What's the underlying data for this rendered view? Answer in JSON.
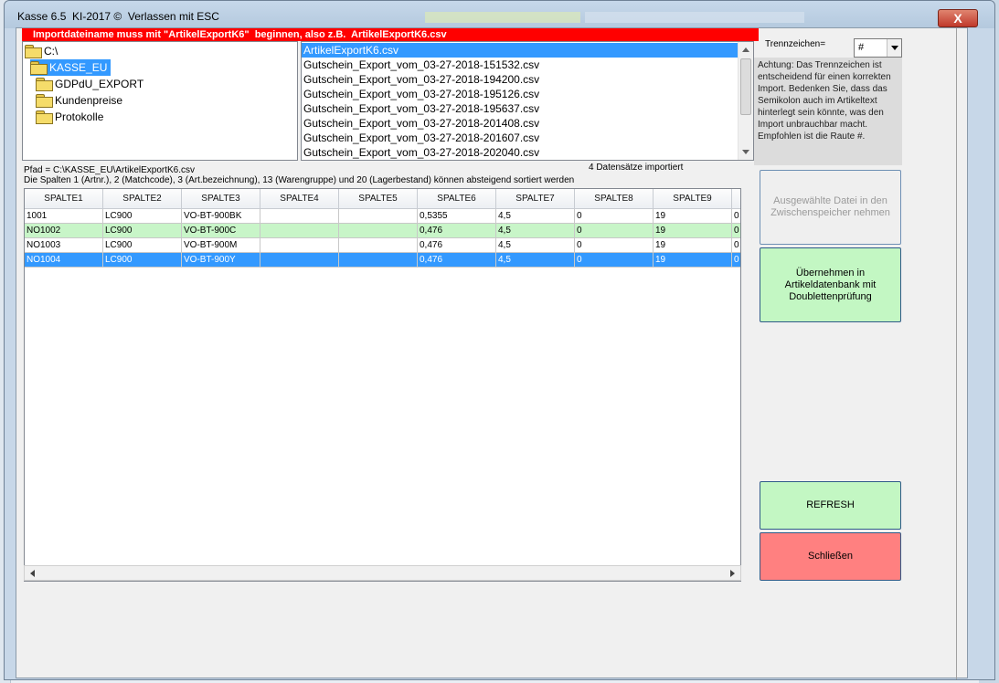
{
  "window": {
    "title": "Kasse 6.5  KI-2017 ©  Verlassen mit ESC",
    "close_label": "X"
  },
  "warning_bar": "Importdateiname muss mit \"ArtikelExportK6\"  beginnen, also z.B.  ArtikelExportK6.csv",
  "folders": [
    {
      "label": "C:\\",
      "level": 0,
      "selected": false
    },
    {
      "label": "KASSE_EU",
      "level": 1,
      "selected": true
    },
    {
      "label": "GDPdU_EXPORT",
      "level": 2,
      "selected": false
    },
    {
      "label": "Kundenpreise",
      "level": 2,
      "selected": false
    },
    {
      "label": "Protokolle",
      "level": 2,
      "selected": false
    }
  ],
  "files": [
    {
      "name": "ArtikelExportK6.csv",
      "selected": true
    },
    {
      "name": "Gutschein_Export_vom_03-27-2018-151532.csv",
      "selected": false
    },
    {
      "name": "Gutschein_Export_vom_03-27-2018-194200.csv",
      "selected": false
    },
    {
      "name": "Gutschein_Export_vom_03-27-2018-195126.csv",
      "selected": false
    },
    {
      "name": "Gutschein_Export_vom_03-27-2018-195637.csv",
      "selected": false
    },
    {
      "name": "Gutschein_Export_vom_03-27-2018-201408.csv",
      "selected": false
    },
    {
      "name": "Gutschein_Export_vom_03-27-2018-201607.csv",
      "selected": false
    },
    {
      "name": "Gutschein_Export_vom_03-27-2018-202040.csv",
      "selected": false
    }
  ],
  "path_text": "Pfad =  C:\\KASSE_EU\\ArtikelExportK6.csv",
  "records_text": "4  Datensätze importiert",
  "sort_hint": "Die Spalten 1 (Artnr.), 2 (Matchcode), 3 (Art.bezeichnung), 13 (Warengruppe) und 20 (Lagerbestand) können absteigend sortiert werden",
  "table": {
    "columns": [
      "SPALTE1",
      "SPALTE2",
      "SPALTE3",
      "SPALTE4",
      "SPALTE5",
      "SPALTE6",
      "SPALTE7",
      "SPALTE8",
      "SPALTE9"
    ],
    "rows": [
      {
        "state": "normal",
        "cells": [
          "1001",
          "LC900",
          "VO-BT-900BK",
          "",
          "",
          "0,5355",
          "4,5",
          "0",
          "19",
          "0"
        ]
      },
      {
        "state": "green",
        "cells": [
          "NO1002",
          "LC900",
          "VO-BT-900C",
          "",
          "",
          "0,476",
          "4,5",
          "0",
          "19",
          "0"
        ]
      },
      {
        "state": "normal",
        "cells": [
          "NO1003",
          "LC900",
          "VO-BT-900M",
          "",
          "",
          "0,476",
          "4,5",
          "0",
          "19",
          "0"
        ]
      },
      {
        "state": "selected",
        "cells": [
          "NO1004",
          "LC900",
          "VO-BT-900Y",
          "",
          "",
          "0,476",
          "4,5",
          "0",
          "19",
          "0"
        ]
      }
    ]
  },
  "separator": {
    "label": "Trennzeichen=",
    "value": "#",
    "note": "Achtung: Das Trennzeichen ist entscheidend für einen korrekten Import. Bedenken Sie, dass das Semikolon auch im Artikeltext hinterlegt sein könnte, was den Import unbrauchbar macht. Empfohlen ist die Raute #."
  },
  "buttons": {
    "clipboard": "Ausgewählte Datei in den Zwischenspeicher nehmen",
    "import": "Übernehmen in Artikeldatenbank mit Doublettenprüfung",
    "refresh": "REFRESH",
    "close": "Schließen"
  },
  "colors": {
    "warning_red": "#ff0000",
    "selection_blue": "#3399ff",
    "row_green": "#c8f5c8",
    "button_green": "#c3f7c3",
    "button_red": "#ff8080"
  }
}
